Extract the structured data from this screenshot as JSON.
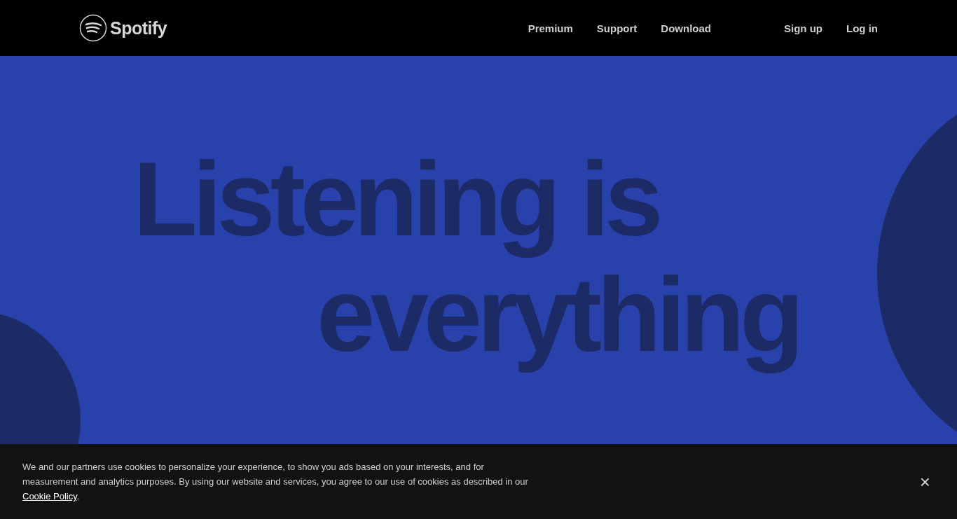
{
  "header": {
    "logo": "Spotify",
    "nav": [
      "Premium",
      "Support",
      "Download"
    ],
    "account": [
      "Sign up",
      "Log in"
    ]
  },
  "hero": {
    "lines": [
      "Listening is",
      "everything"
    ]
  },
  "cookie_banner": {
    "text": "We and our partners use cookies to personalize your experience, to show you ads based on your interests, and for measurement and analytics purposes. By using our website and services, you agree to our use of cookies as described in our",
    "link": "Cookie Policy",
    "after_link": ".",
    "close": "×"
  }
}
